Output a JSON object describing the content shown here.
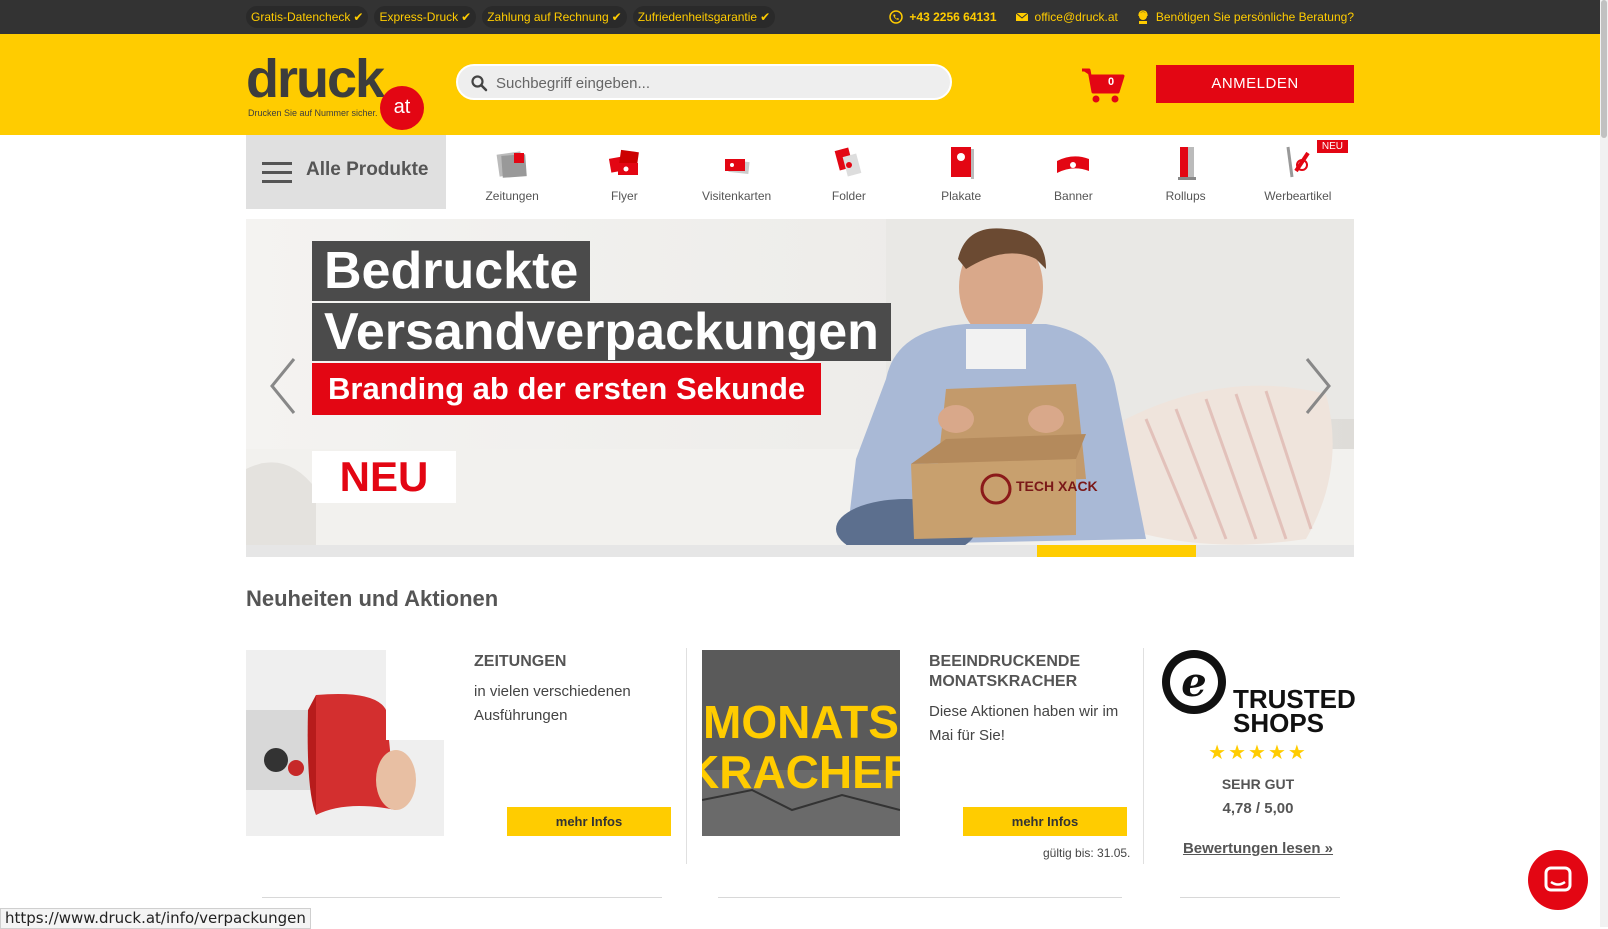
{
  "topbar": {
    "usps": [
      "Gratis-Datencheck",
      "Express-Druck",
      "Zahlung auf Rechnung",
      "Zufriedenheitsgarantie"
    ],
    "phone": "+43 2256 64131",
    "email": "office@druck.at",
    "advice": "Benötigen Sie persönliche Beratung?"
  },
  "header": {
    "logo_word": "druck",
    "logo_at": "at",
    "logo_tagline": "Drucken Sie auf Nummer sicher.",
    "search_placeholder": "Suchbegriff eingeben...",
    "cart_count": "0",
    "login_label": "ANMELDEN"
  },
  "nav": {
    "all_products": "Alle Produkte",
    "categories": [
      {
        "label": "Zeitungen",
        "icon": "newspaper-icon"
      },
      {
        "label": "Flyer",
        "icon": "flyer-icon"
      },
      {
        "label": "Visitenkarten",
        "icon": "business-card-icon"
      },
      {
        "label": "Folder",
        "icon": "folder-icon"
      },
      {
        "label": "Plakate",
        "icon": "poster-icon"
      },
      {
        "label": "Banner",
        "icon": "banner-icon"
      },
      {
        "label": "Rollups",
        "icon": "rollup-icon"
      },
      {
        "label": "Werbeartikel",
        "icon": "promo-items-icon",
        "badge": "NEU"
      }
    ]
  },
  "hero": {
    "line1": "Bedruckte",
    "line2": "Versandverpackungen",
    "subline": "Branding ab der ersten Sekunde",
    "badge": "NEU",
    "box_brand": "TECH XACK",
    "active_slide": 5,
    "slide_count": 7
  },
  "section": {
    "title": "Neuheiten und Aktionen",
    "cards": [
      {
        "title": "ZEITUNGEN",
        "text": "in vielen verschiedenen Ausführungen",
        "button": "mehr Infos"
      },
      {
        "title": "BEEINDRUCKENDE MONATSKRACHER",
        "text": "Diese Aktionen haben wir im Mai für Sie!",
        "button": "mehr Infos",
        "valid": "gültig bis: 31.05.",
        "image_text": "MONATS KRACHER"
      }
    ],
    "trusted": {
      "brand_line1": "TRUSTED",
      "brand_line2": "SHOPS",
      "stars": "★★★★★",
      "rating_word": "SEHR GUT",
      "rating": "4,78 / 5,00",
      "reviews_link": "Bewertungen lesen »"
    }
  },
  "statusbar": {
    "url": "https://www.druck.at/info/verpackungen"
  },
  "colors": {
    "brand_yellow": "#ffcc00",
    "brand_red": "#e30613",
    "dark": "#333333"
  }
}
